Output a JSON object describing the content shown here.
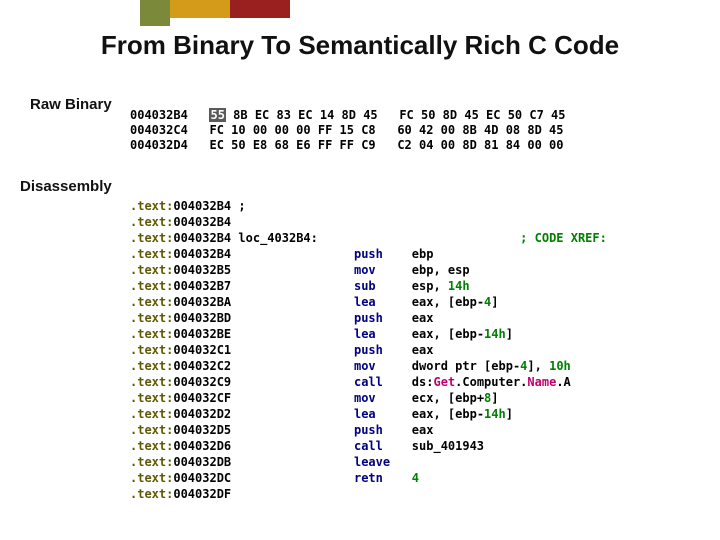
{
  "accent_colors": [
    "#7b8a3a",
    "#d49a1a",
    "#9a1f1f"
  ],
  "title": "From Binary To Semantically Rich C Code",
  "labels": {
    "raw_binary": "Raw Binary",
    "disassembly": "Disassembly"
  },
  "hex_rows": [
    {
      "addr": "004032B4",
      "highlight": "55",
      "rest": " 8B EC 83 EC 14 8D 45   FC 50 8D 45 EC 50 C7 45"
    },
    {
      "addr": "004032C4",
      "highlight": "",
      "rest": "FC 10 00 00 00 FF 15 C8   60 42 00 8B 4D 08 8D 45"
    },
    {
      "addr": "004032D4",
      "highlight": "",
      "rest": "EC 50 E8 68 E6 FF FF C9   C2 04 00 8D 81 84 00 00"
    }
  ],
  "asm_rows": [
    {
      "seg": ".text:",
      "addr": "004032B4",
      "sp": " ",
      "plain": ";",
      "mnem": "",
      "arg": "",
      "trail": ""
    },
    {
      "seg": ".text:",
      "addr": "004032B4",
      "sp": "",
      "plain": "",
      "mnem": "",
      "arg": "",
      "trail": ""
    },
    {
      "seg": ".text:",
      "addr": "004032B4",
      "sp": " ",
      "plain": "loc_4032B4:",
      "mnem": "",
      "arg": "",
      "trail": "                            ; CODE XREF:"
    },
    {
      "seg": ".text:",
      "addr": "004032B4",
      "sp": "                 ",
      "plain": "",
      "mnem": "push",
      "arg": "    ebp",
      "trail": ""
    },
    {
      "seg": ".text:",
      "addr": "004032B5",
      "sp": "                 ",
      "plain": "",
      "mnem": "mov",
      "arg": "     ebp, esp",
      "trail": ""
    },
    {
      "seg": ".text:",
      "addr": "004032B7",
      "sp": "                 ",
      "plain": "",
      "mnem": "sub",
      "arg": "     esp, |14h|",
      "trail": ""
    },
    {
      "seg": ".text:",
      "addr": "004032BA",
      "sp": "                 ",
      "plain": "",
      "mnem": "lea",
      "arg": "     eax, [ebp-|4|]",
      "trail": ""
    },
    {
      "seg": ".text:",
      "addr": "004032BD",
      "sp": "                 ",
      "plain": "",
      "mnem": "push",
      "arg": "    eax",
      "trail": ""
    },
    {
      "seg": ".text:",
      "addr": "004032BE",
      "sp": "                 ",
      "plain": "",
      "mnem": "lea",
      "arg": "     eax, [ebp-|14h|]",
      "trail": ""
    },
    {
      "seg": ".text:",
      "addr": "004032C1",
      "sp": "                 ",
      "plain": "",
      "mnem": "push",
      "arg": "    eax",
      "trail": ""
    },
    {
      "seg": ".text:",
      "addr": "004032C2",
      "sp": "                 ",
      "plain": "",
      "mnem": "mov",
      "arg": "     dword ptr [ebp-|4|], |10h|",
      "trail": ""
    },
    {
      "seg": ".text:",
      "addr": "004032C9",
      "sp": "                 ",
      "plain": "",
      "mnem": "call",
      "arg": "    ds:@Get@Computer@Name@A",
      "trail": ""
    },
    {
      "seg": ".text:",
      "addr": "004032CF",
      "sp": "                 ",
      "plain": "",
      "mnem": "mov",
      "arg": "     ecx, [ebp+|8|]",
      "trail": ""
    },
    {
      "seg": ".text:",
      "addr": "004032D2",
      "sp": "                 ",
      "plain": "",
      "mnem": "lea",
      "arg": "     eax, [ebp-|14h|]",
      "trail": ""
    },
    {
      "seg": ".text:",
      "addr": "004032D5",
      "sp": "                 ",
      "plain": "",
      "mnem": "push",
      "arg": "    eax",
      "trail": ""
    },
    {
      "seg": ".text:",
      "addr": "004032D6",
      "sp": "                 ",
      "plain": "",
      "mnem": "call",
      "arg": "    sub_401943",
      "trail": ""
    },
    {
      "seg": ".text:",
      "addr": "004032DB",
      "sp": "                 ",
      "plain": "",
      "mnem": "leave",
      "arg": "",
      "trail": ""
    },
    {
      "seg": ".text:",
      "addr": "004032DC",
      "sp": "                 ",
      "plain": "",
      "mnem": "retn",
      "arg": "    |4|",
      "trail": ""
    },
    {
      "seg": ".text:",
      "addr": "004032DF",
      "sp": "",
      "plain": "",
      "mnem": "",
      "arg": "",
      "trail": ""
    }
  ]
}
